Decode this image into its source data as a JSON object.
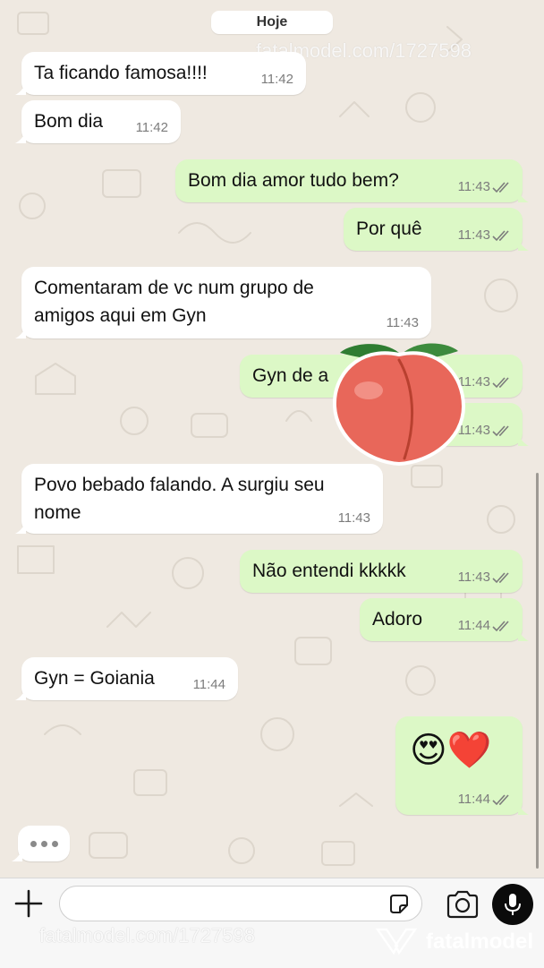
{
  "date_divider": "Hoje",
  "watermark": {
    "top": "fatalmodel.com/1727598",
    "bottom": "fatalmodel.com/1727598",
    "brand": "fatalmodel"
  },
  "messages": [
    {
      "direction": "incoming",
      "text": "Ta ficando famosa!!!!",
      "time": "11:42"
    },
    {
      "direction": "incoming",
      "text": "Bom dia",
      "time": "11:42"
    },
    {
      "direction": "outgoing",
      "text": "Bom dia amor tudo bem?",
      "time": "11:43",
      "status": "read"
    },
    {
      "direction": "outgoing",
      "text": "Por quê",
      "time": "11:43",
      "status": "read"
    },
    {
      "direction": "incoming",
      "text": "Comentaram de vc num grupo de amigos aqui em Gyn",
      "time": "11:43"
    },
    {
      "direction": "outgoing",
      "text": "Gyn de a",
      "time": "11:43",
      "status": "read"
    },
    {
      "direction": "outgoing",
      "text": "",
      "time": "11:43",
      "status": "read"
    },
    {
      "direction": "incoming",
      "text": "Povo bebado falando. A surgiu seu nome",
      "time": "11:43"
    },
    {
      "direction": "outgoing",
      "text": "Não entendi kkkkk",
      "time": "11:43",
      "status": "read"
    },
    {
      "direction": "outgoing",
      "text": "Adoro",
      "time": "11:44",
      "status": "read"
    },
    {
      "direction": "incoming",
      "text": "Gyn = Goiania",
      "time": "11:44"
    },
    {
      "direction": "outgoing",
      "text": "😍❤️",
      "time": "11:44",
      "status": "read"
    }
  ],
  "sticker": {
    "icon": "peach-icon"
  },
  "typing_indicator": {
    "icon": "typing-dots-icon"
  },
  "composer": {
    "placeholder": "",
    "icons": [
      "plus-icon",
      "sticker-icon",
      "camera-icon",
      "microphone-icon"
    ]
  },
  "colors": {
    "background": "#efe9e1",
    "incoming_bubble": "#ffffff",
    "outgoing_bubble": "#dcf8c6",
    "read_ticks": "#7c7c7c"
  }
}
